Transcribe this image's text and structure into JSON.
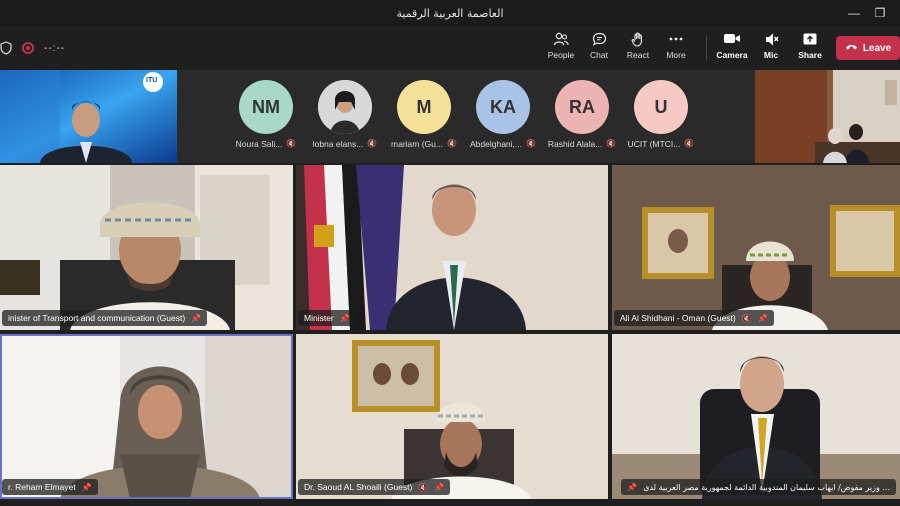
{
  "window": {
    "title": "العاصمة العربية الرقمية"
  },
  "toolbar": {
    "timer": "--:--",
    "buttons": [
      {
        "id": "people",
        "label": "People",
        "icon": "people-icon"
      },
      {
        "id": "chat",
        "label": "Chat",
        "icon": "chat-icon"
      },
      {
        "id": "react",
        "label": "React",
        "icon": "hand-icon"
      },
      {
        "id": "more",
        "label": "More",
        "icon": "more-icon"
      },
      {
        "id": "camera",
        "label": "Camera",
        "icon": "camera-icon"
      },
      {
        "id": "mic",
        "label": "Mic",
        "icon": "mic-icon"
      },
      {
        "id": "share",
        "label": "Share",
        "icon": "share-icon"
      }
    ],
    "leave_label": "Leave"
  },
  "strip": {
    "participants": [
      {
        "initials": "NM",
        "name": "Noura Sali...",
        "color": "#a8d8c8"
      },
      {
        "initials": "",
        "name": "lobna elans...",
        "color": "#cfcfcf"
      },
      {
        "initials": "M",
        "name": "mariam (Gu...",
        "color": "#f3e19a"
      },
      {
        "initials": "KA",
        "name": "Abdelghani,...",
        "color": "#a9c3e6"
      },
      {
        "initials": "RA",
        "name": "Rashid Alala...",
        "color": "#eeb4b4"
      },
      {
        "initials": "U",
        "name": "UCIT (MTCI...",
        "color": "#f7c9c4"
      }
    ],
    "left_video_logo": "ITU"
  },
  "tiles": [
    {
      "name": "inister of Transport and communication (Guest)"
    },
    {
      "name": "Minister"
    },
    {
      "name": "Ali Al Shidhani - Oman (Guest)"
    },
    {
      "name": "r. Reham Elmayet"
    },
    {
      "name": "Dr. Saoud AL Shoaili (Guest)"
    },
    {
      "name": "وزير مفوض/ ايهاب سليمان المندوبية الدائمة لجمهورية مصر العربية لدى ..."
    }
  ],
  "colors": {
    "leave": "#c4314b",
    "active_outline": "#6f6fc8"
  }
}
